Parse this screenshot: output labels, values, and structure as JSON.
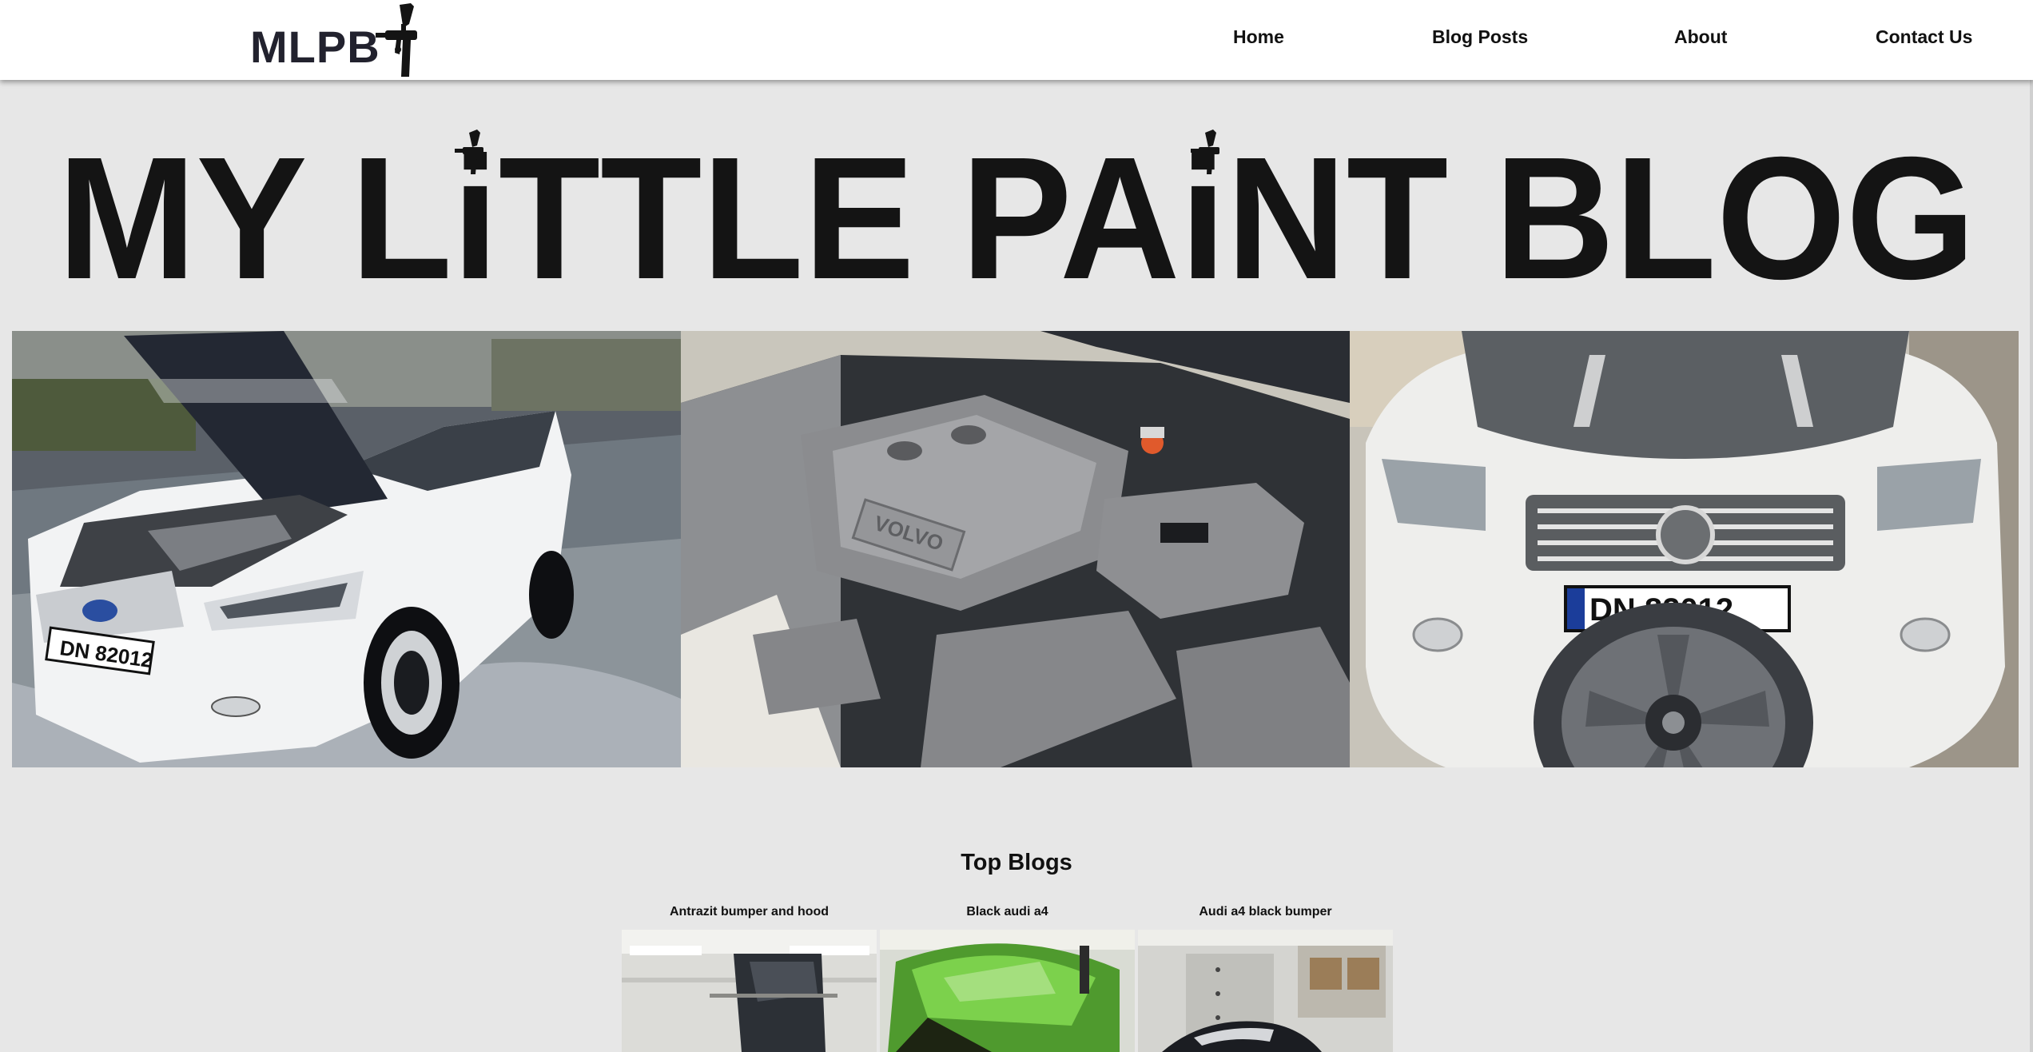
{
  "header": {
    "logo_text": "MLPB",
    "nav": [
      {
        "label": "Home"
      },
      {
        "label": "Blog Posts"
      },
      {
        "label": "About"
      },
      {
        "label": "Contact Us"
      }
    ]
  },
  "hero": {
    "title": "MY LiTTLE PAiNT BLOG"
  },
  "gallery": {
    "photos": [
      {
        "subject": "white-volvo-hood-open",
        "plate": "DN 82012"
      },
      {
        "subject": "volvo-engine-bay",
        "engine_cover_text": "VOLVO"
      },
      {
        "subject": "volvo-front-with-wheel",
        "plate": "DN 82012"
      }
    ]
  },
  "top_blogs": {
    "title": "Top Blogs",
    "posts": [
      {
        "title": "Antrazit bumper and hood"
      },
      {
        "title": "Black audi a4"
      },
      {
        "title": "Audi a4 black bumper"
      }
    ]
  },
  "colors": {
    "page_bg": "#e7e7e7",
    "header_bg": "#ffffff",
    "title_color": "#141414",
    "logo_color": "#22222e"
  }
}
